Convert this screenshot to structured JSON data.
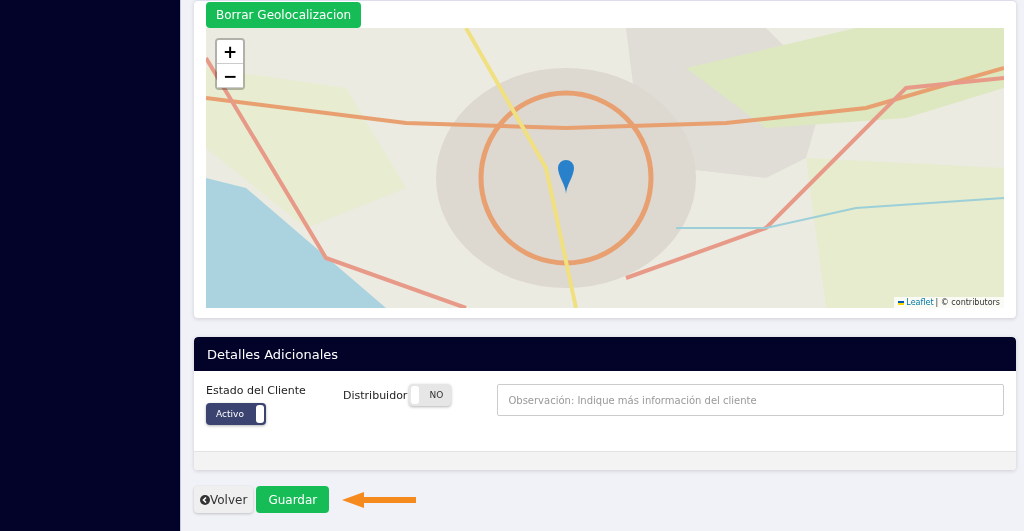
{
  "location_card": {
    "clear_button": "Borrar Geolocalizacion",
    "map": {
      "zoom_in": "+",
      "zoom_out": "−",
      "attribution_link": "Leaflet",
      "attribution_text": "| © contributors"
    }
  },
  "details_card": {
    "title": "Detalles Adicionales",
    "status": {
      "label": "Estado del Cliente",
      "toggle_text": "Activo",
      "on": true
    },
    "distributor": {
      "label": "Distribuidor",
      "toggle_text": "NO",
      "on": false
    },
    "observation": {
      "placeholder": "Observación: Indique más información del cliente"
    }
  },
  "actions": {
    "back_button": "Volver",
    "save_button": "Guardar"
  }
}
